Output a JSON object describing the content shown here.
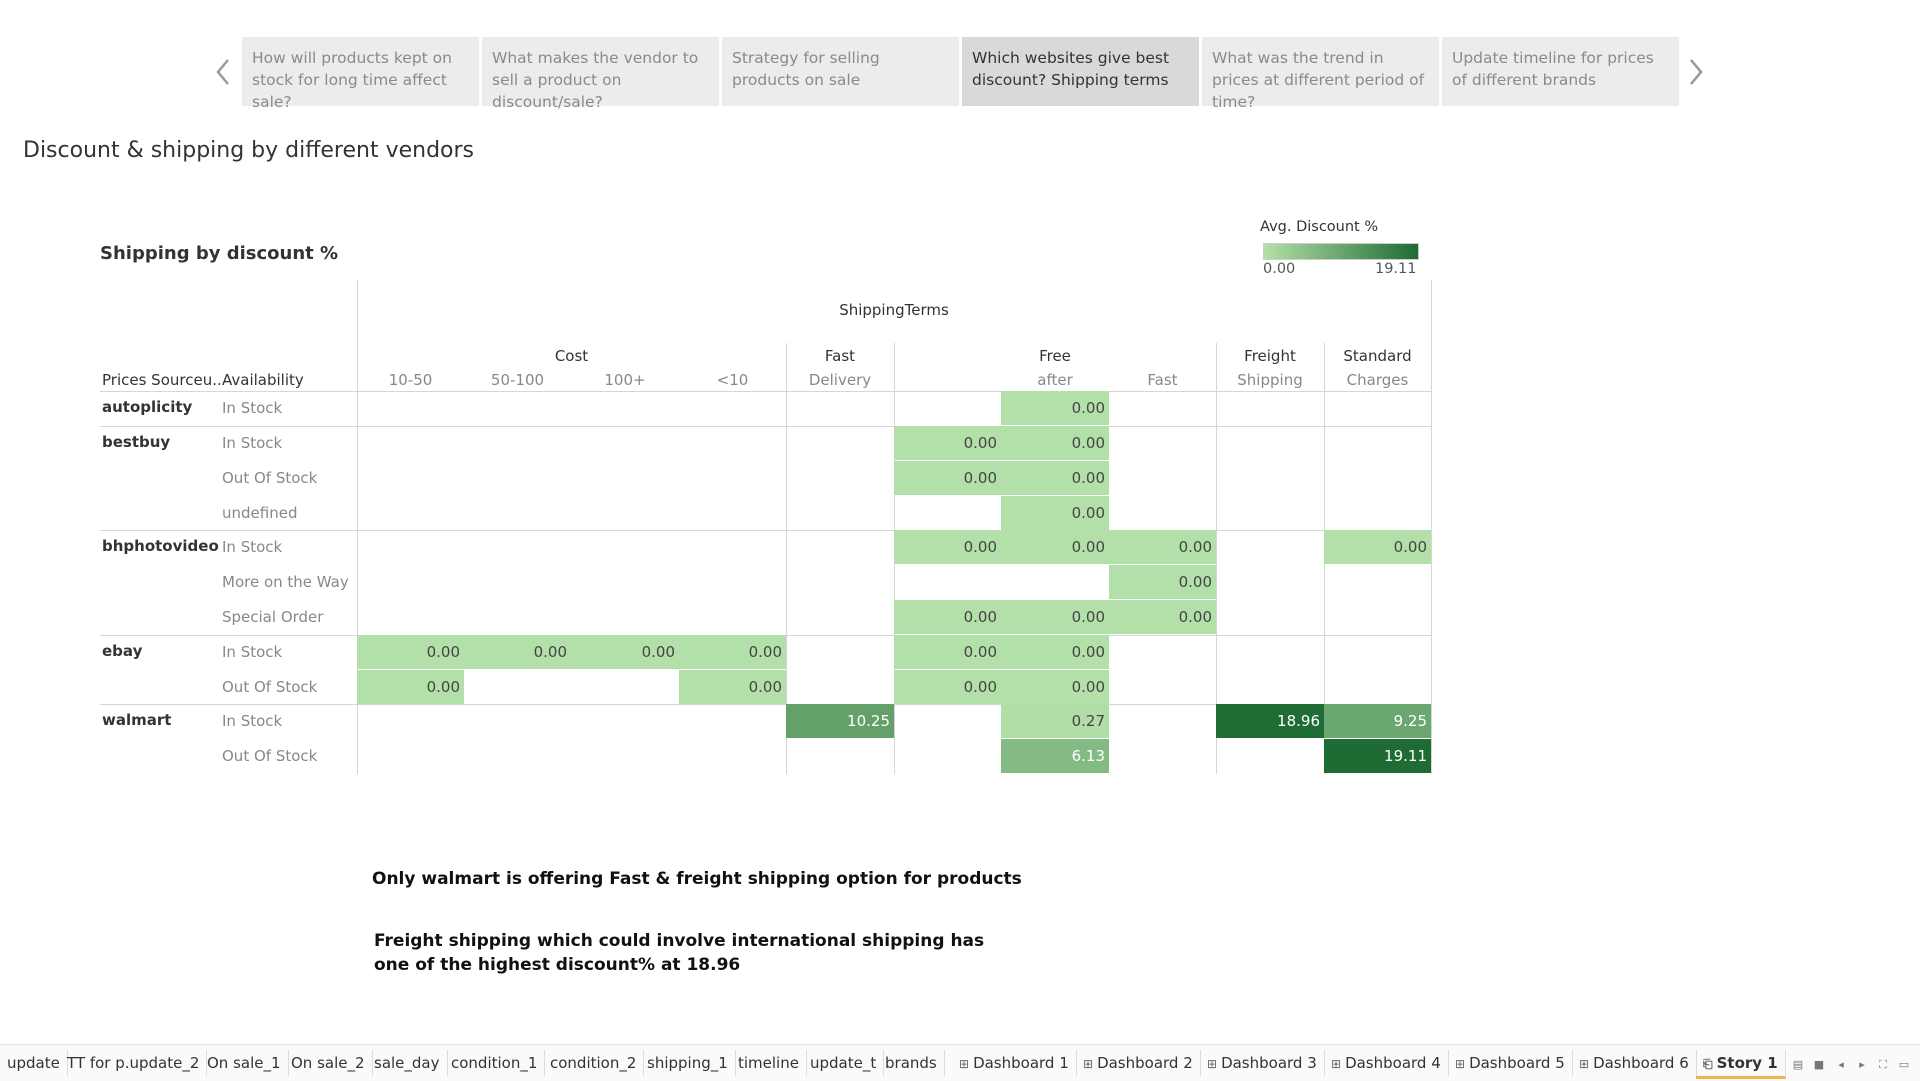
{
  "story_nav": {
    "points": [
      "How will products kept on stock for long time affect sale?",
      "What makes the vendor to sell a product on discount/sale?",
      "Strategy for selling products on sale",
      "Which websites give best discount? Shipping terms",
      "What was the trend in prices at different period of time?",
      "Update timeline for prices of different brands"
    ],
    "active_index": 3
  },
  "dashboard_title": "Discount & shipping by different vendors",
  "sheet_title": "Shipping by discount %",
  "legend": {
    "title": "Avg. Discount %",
    "min": "0.00",
    "max": "19.11",
    "color_low": "#b3e0a8",
    "color_high": "#1f6b34"
  },
  "table": {
    "col_field": "ShippingTerms",
    "row_headers": [
      "Prices Sourceu..",
      "Availability"
    ],
    "groups": [
      "Cost",
      "Fast",
      "Free",
      "Freight",
      "Standard"
    ],
    "subcols": [
      "10-50",
      "50-100",
      "100+",
      "<10",
      "Delivery",
      "",
      "after",
      "Fast",
      "Shipping",
      "Charges"
    ],
    "sources": [
      "autoplicity",
      "bestbuy",
      "bhphotovideo",
      "ebay",
      "walmart"
    ],
    "availability": [
      "In Stock",
      "In Stock",
      "Out Of Stock",
      "undefined",
      "In Stock",
      "More on the Way",
      "Special Order",
      "In Stock",
      "Out Of Stock",
      "In Stock",
      "Out Of Stock"
    ],
    "cells": [
      {
        "row": 0,
        "col": 6,
        "value": "0.00"
      },
      {
        "row": 1,
        "col": 5,
        "value": "0.00"
      },
      {
        "row": 1,
        "col": 6,
        "value": "0.00"
      },
      {
        "row": 2,
        "col": 5,
        "value": "0.00"
      },
      {
        "row": 2,
        "col": 6,
        "value": "0.00"
      },
      {
        "row": 3,
        "col": 6,
        "value": "0.00"
      },
      {
        "row": 4,
        "col": 5,
        "value": "0.00"
      },
      {
        "row": 4,
        "col": 6,
        "value": "0.00"
      },
      {
        "row": 4,
        "col": 7,
        "value": "0.00"
      },
      {
        "row": 4,
        "col": 9,
        "value": "0.00"
      },
      {
        "row": 5,
        "col": 7,
        "value": "0.00"
      },
      {
        "row": 6,
        "col": 5,
        "value": "0.00"
      },
      {
        "row": 6,
        "col": 6,
        "value": "0.00"
      },
      {
        "row": 6,
        "col": 7,
        "value": "0.00"
      },
      {
        "row": 7,
        "col": 0,
        "value": "0.00"
      },
      {
        "row": 7,
        "col": 1,
        "value": "0.00"
      },
      {
        "row": 7,
        "col": 2,
        "value": "0.00"
      },
      {
        "row": 7,
        "col": 3,
        "value": "0.00"
      },
      {
        "row": 7,
        "col": 5,
        "value": "0.00"
      },
      {
        "row": 7,
        "col": 6,
        "value": "0.00"
      },
      {
        "row": 8,
        "col": 0,
        "value": "0.00"
      },
      {
        "row": 8,
        "col": 3,
        "value": "0.00"
      },
      {
        "row": 8,
        "col": 5,
        "value": "0.00"
      },
      {
        "row": 8,
        "col": 6,
        "value": "0.00"
      },
      {
        "row": 9,
        "col": 4,
        "value": "10.25"
      },
      {
        "row": 9,
        "col": 6,
        "value": "0.27"
      },
      {
        "row": 9,
        "col": 8,
        "value": "18.96"
      },
      {
        "row": 9,
        "col": 9,
        "value": "9.25"
      },
      {
        "row": 10,
        "col": 6,
        "value": "6.13"
      },
      {
        "row": 10,
        "col": 9,
        "value": "19.11"
      }
    ]
  },
  "notes": [
    "Only walmart is offering Fast & freight shipping option for products",
    "Freight shipping which could involve international shipping has one of the highest discount% at 18.96"
  ],
  "tabs": [
    {
      "label": "update",
      "icon": ""
    },
    {
      "label": "TT for p.update_2",
      "icon": ""
    },
    {
      "label": "On sale_1",
      "icon": ""
    },
    {
      "label": "On sale_2",
      "icon": ""
    },
    {
      "label": "sale_day",
      "icon": ""
    },
    {
      "label": "condition_1",
      "icon": ""
    },
    {
      "label": "condition_2",
      "icon": ""
    },
    {
      "label": "shipping_1",
      "icon": ""
    },
    {
      "label": "timeline",
      "icon": ""
    },
    {
      "label": "update_t",
      "icon": ""
    },
    {
      "label": "brands",
      "icon": ""
    },
    {
      "label": "Dashboard 1",
      "icon": "dashboard-icon"
    },
    {
      "label": "Dashboard 2",
      "icon": "dashboard-icon"
    },
    {
      "label": "Dashboard 3",
      "icon": "dashboard-icon"
    },
    {
      "label": "Dashboard 4",
      "icon": "dashboard-icon"
    },
    {
      "label": "Dashboard 5",
      "icon": "dashboard-icon"
    },
    {
      "label": "Dashboard 6",
      "icon": "dashboard-icon"
    },
    {
      "label": "Story 1",
      "icon": "story-icon"
    }
  ],
  "active_tab": 17
}
